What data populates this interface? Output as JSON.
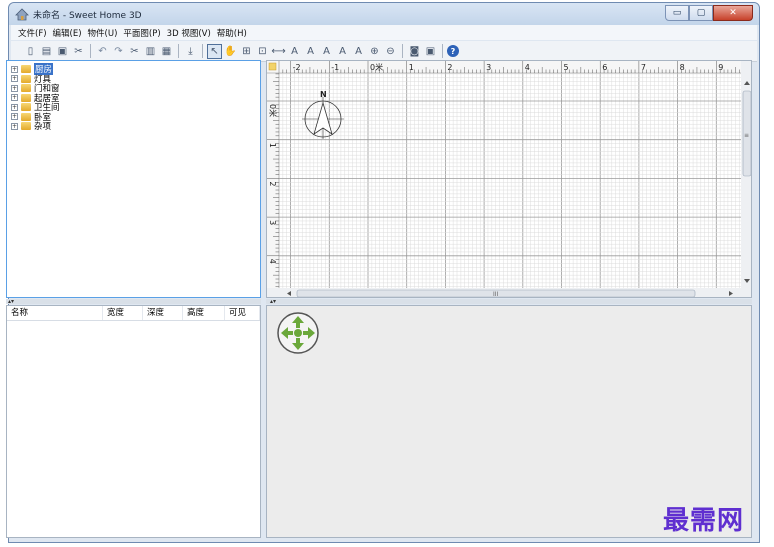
{
  "window": {
    "title": "未命名 - Sweet Home 3D"
  },
  "title_buttons": {
    "minimize": "▭",
    "maximize": "▢",
    "close": "✕"
  },
  "menu": [
    {
      "label": "文件(F)"
    },
    {
      "label": "编辑(E)"
    },
    {
      "label": "物件(U)"
    },
    {
      "label": "平面图(P)"
    },
    {
      "label": "3D 视图(V)"
    },
    {
      "label": "帮助(H)"
    }
  ],
  "toolbar": [
    {
      "name": "new-home-icon",
      "glyph": "▯"
    },
    {
      "name": "open-icon",
      "glyph": "▤"
    },
    {
      "name": "save-icon",
      "glyph": "▣"
    },
    {
      "name": "cut-prefs-icon",
      "glyph": "✂"
    },
    {
      "sep": true
    },
    {
      "name": "undo-icon",
      "glyph": "↶"
    },
    {
      "name": "redo-icon",
      "glyph": "↷"
    },
    {
      "name": "cut-icon",
      "glyph": "✂"
    },
    {
      "name": "copy-icon",
      "glyph": "▥"
    },
    {
      "name": "paste-icon",
      "glyph": "▦"
    },
    {
      "sep": true
    },
    {
      "name": "add-furniture-icon",
      "glyph": "⤓"
    },
    {
      "sep": true
    },
    {
      "name": "select-mode-icon",
      "glyph": "↖",
      "pressed": true
    },
    {
      "name": "pan-mode-icon",
      "glyph": "✋"
    },
    {
      "name": "create-walls-icon",
      "glyph": "⊞"
    },
    {
      "name": "create-rooms-icon",
      "glyph": "⊡"
    },
    {
      "name": "create-dimensions-icon",
      "glyph": "⟷"
    },
    {
      "name": "create-labels-icon",
      "glyph": "A"
    },
    {
      "name": "increase-text-icon",
      "glyph": "A"
    },
    {
      "name": "decrease-text-icon",
      "glyph": "A"
    },
    {
      "name": "bold-text-icon",
      "glyph": "A"
    },
    {
      "name": "italic-text-icon",
      "glyph": "A"
    },
    {
      "name": "zoom-in-icon",
      "glyph": "⊕"
    },
    {
      "name": "zoom-out-icon",
      "glyph": "⊖"
    },
    {
      "sep": true
    },
    {
      "name": "create-photo-icon",
      "glyph": "◙"
    },
    {
      "name": "create-video-icon",
      "glyph": "▣"
    },
    {
      "sep": true
    },
    {
      "name": "help-icon",
      "glyph": "?"
    }
  ],
  "catalog": {
    "categories": [
      {
        "label": "厨房",
        "selected": true
      },
      {
        "label": "灯具"
      },
      {
        "label": "门和窗"
      },
      {
        "label": "起居室"
      },
      {
        "label": "卫生间"
      },
      {
        "label": "卧室"
      },
      {
        "label": "杂项"
      }
    ],
    "expand_glyph": "+"
  },
  "furniture_table": {
    "columns": [
      {
        "label": "名称"
      },
      {
        "label": "宽度"
      },
      {
        "label": "深度"
      },
      {
        "label": "高度"
      },
      {
        "label": "可见"
      }
    ]
  },
  "plan": {
    "x_ruler": [
      "-2",
      "-1",
      "0米",
      "1",
      "2",
      "3",
      "4",
      "5",
      "6",
      "7",
      "8",
      "9"
    ],
    "y_ruler": [
      "0米",
      "1",
      "2",
      "3",
      "4"
    ],
    "compass_label": "N",
    "hscroll_grip": "III",
    "vscroll_grip": "≡"
  },
  "watermark": "最需网",
  "colors": {
    "selection": "#3a73c9",
    "navigator_green": "#6aa83a",
    "watermark": "#5f2fd0"
  }
}
